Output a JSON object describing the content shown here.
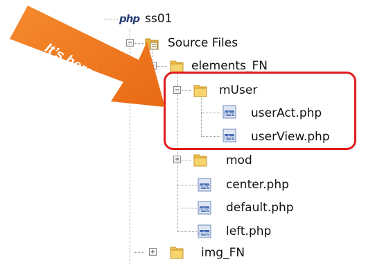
{
  "tree": {
    "project": {
      "label": "ss01",
      "icon": "php-project-icon"
    },
    "source_files": {
      "label": "Source Files",
      "toggle": "−",
      "icon": "source-folder-icon"
    },
    "elements_fn": {
      "label": "elements_FN",
      "toggle": "−",
      "icon": "folder-icon"
    },
    "muser": {
      "label": "mUser",
      "toggle": "−",
      "icon": "folder-icon"
    },
    "user_act": {
      "label": "userAct.php",
      "icon": "php-file-icon"
    },
    "user_view": {
      "label": "userView.php",
      "icon": "php-file-icon"
    },
    "mod": {
      "label": "mod",
      "toggle": "+",
      "icon": "folder-icon"
    },
    "center": {
      "label": "center.php",
      "icon": "php-file-icon"
    },
    "default": {
      "label": "default.php",
      "icon": "php-file-icon"
    },
    "left": {
      "label": "left.php",
      "icon": "php-file-icon"
    },
    "img_fn": {
      "label": "img_FN",
      "toggle": "+",
      "icon": "folder-icon"
    }
  },
  "callout": {
    "text": "It’s here",
    "arrow_color": "#f07c22",
    "highlight_color": "#e01a1a"
  },
  "colors": {
    "folder": "#f2c14e",
    "php_file_blue": "#4a6fb5"
  }
}
